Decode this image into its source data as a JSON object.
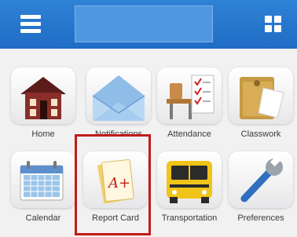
{
  "header": {
    "title": "",
    "menu_icon": "hamburger-menu-icon",
    "apps_icon": "grid-icon"
  },
  "tiles": [
    {
      "label": "Home",
      "icon": "house-icon"
    },
    {
      "label": "Notifications",
      "icon": "envelope-icon"
    },
    {
      "label": "Attendance",
      "icon": "desk-checklist-icon"
    },
    {
      "label": "Classwork",
      "icon": "folder-icon"
    },
    {
      "label": "Calendar",
      "icon": "calendar-icon"
    },
    {
      "label": "Report Card",
      "icon": "report-card-icon"
    },
    {
      "label": "Transportation",
      "icon": "school-bus-icon"
    },
    {
      "label": "Preferences",
      "icon": "wrench-icon"
    }
  ],
  "report_card_grade": "A+",
  "colors": {
    "header": "#2677cf",
    "highlight": "#c21b17",
    "background": "#f1f1f2"
  }
}
